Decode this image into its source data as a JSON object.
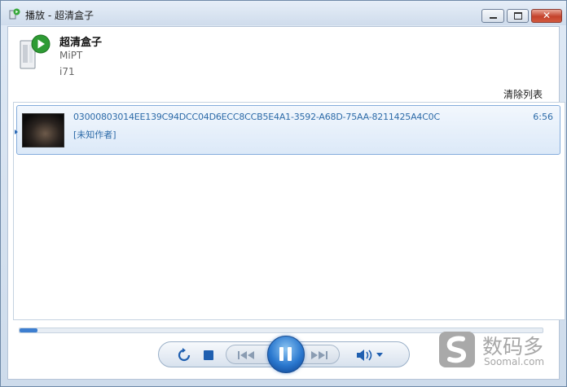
{
  "window": {
    "title": "播放 - 超清盒子",
    "close_glyph": "✕"
  },
  "device": {
    "name": "超清盒子",
    "maker": "MiPT",
    "model": "i71"
  },
  "playlist": {
    "clear_label": "清除列表",
    "items": [
      {
        "title": "03000803014EE139C94DCC04D6ECC8CCB5E4A1-3592-A68D-75AA-8211425A4C0C",
        "artist": "[未知作者]",
        "duration": "6:56"
      }
    ]
  },
  "playback": {
    "progress": 0.035,
    "state": "playing"
  },
  "controls": {
    "repeat_icon": "repeat-icon",
    "stop_icon": "stop-icon",
    "prev_icon": "previous-icon",
    "pause_icon": "pause-icon",
    "next_icon": "next-icon",
    "volume_icon": "volume-icon"
  },
  "watermark": {
    "cn": "数码多",
    "en": "Soomal.com"
  },
  "colors": {
    "accent": "#2d6ba8",
    "selection_border": "#84acdc",
    "progress_fill": "#3d7ed0",
    "close_button": "#c4422c"
  }
}
